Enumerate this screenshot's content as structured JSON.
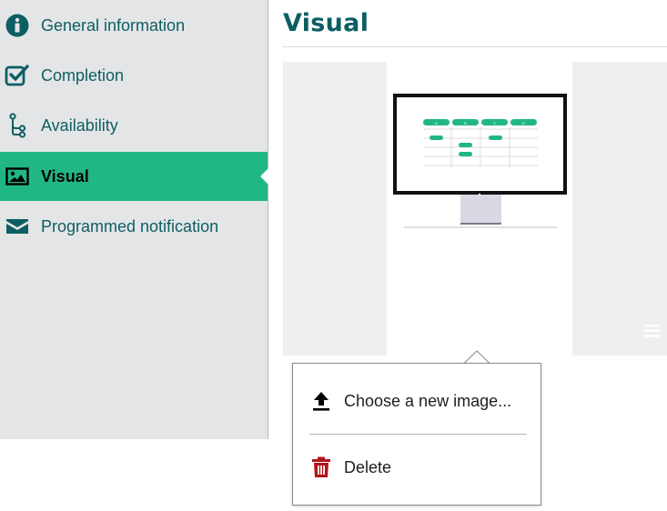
{
  "sidebar": {
    "items": [
      {
        "label": "General information",
        "icon": "info-icon",
        "active": false
      },
      {
        "label": "Completion",
        "icon": "checkbox-checked-icon",
        "active": false
      },
      {
        "label": "Availability",
        "icon": "branch-icon",
        "active": false
      },
      {
        "label": "Visual",
        "icon": "image-icon",
        "active": true
      },
      {
        "label": "Programmed notification",
        "icon": "envelope-icon",
        "active": false
      }
    ]
  },
  "main": {
    "title": "Visual"
  },
  "preview": {
    "table_headers": [
      "A",
      "B",
      "C",
      "D"
    ]
  },
  "popup": {
    "upload_label": "Choose a new image...",
    "delete_label": "Delete"
  },
  "colors": {
    "accent": "#21b783",
    "title": "#0d5e62",
    "sidebar_bg": "#e4e5e7",
    "delete": "#b3141b"
  }
}
